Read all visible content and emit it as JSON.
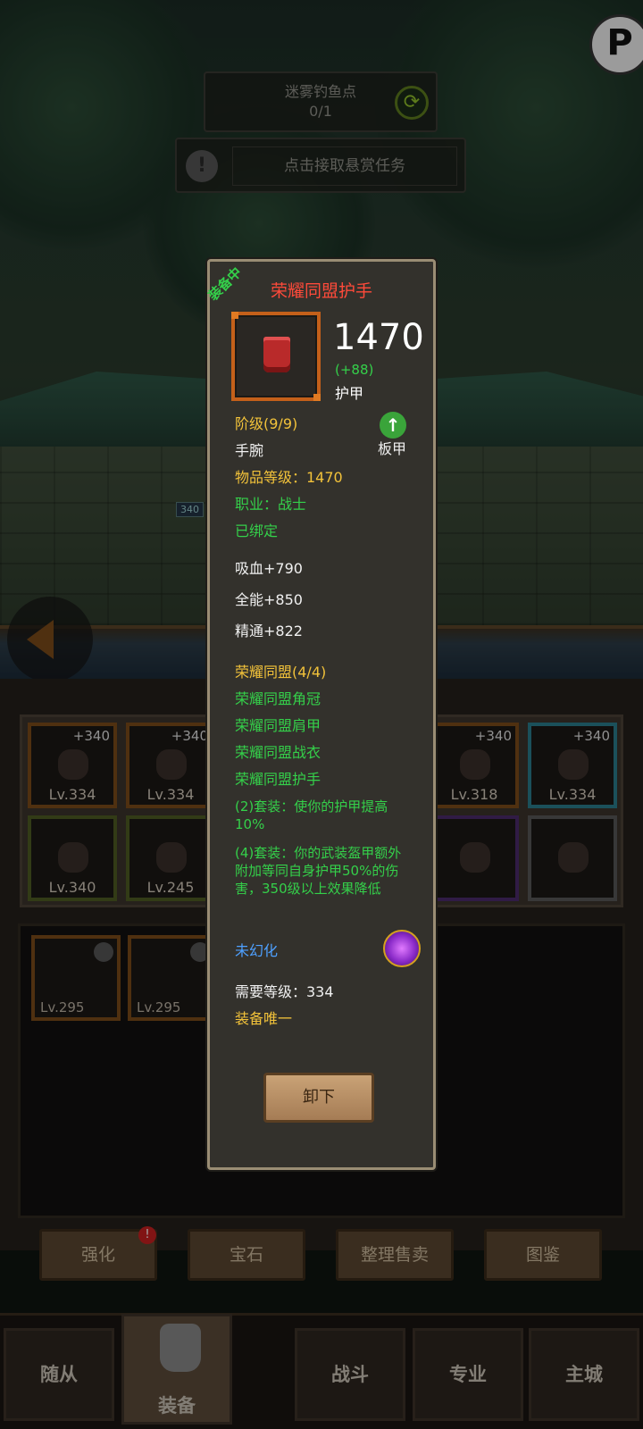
{
  "scene": {
    "quest_title": "迷雾钓鱼点",
    "quest_progress": "0/1",
    "bounty_label": "点击接取悬赏任务",
    "hp_tag": "340"
  },
  "equipped_slots": [
    {
      "plus": "+340",
      "level": "Lv.334"
    },
    {
      "plus": "+340",
      "level": "Lv.334"
    },
    {
      "plus": "+340",
      "level": "Lv.318"
    },
    {
      "plus": "+340",
      "level": "Lv.334"
    },
    {
      "plus": "",
      "level": "Lv.340"
    },
    {
      "plus": "",
      "level": "Lv.245"
    },
    {
      "plus": "",
      "level": ""
    },
    {
      "plus": "",
      "level": ""
    }
  ],
  "bag_items": [
    {
      "level": "Lv.295"
    },
    {
      "level": "Lv.295"
    }
  ],
  "actions": [
    "强化",
    "宝石",
    "整理售卖",
    "图鉴"
  ],
  "nav": {
    "tabs": [
      "随从",
      "装备",
      "战斗",
      "专业",
      "主城"
    ],
    "active": "装备"
  },
  "tooltip": {
    "equipped_tag": "装备中",
    "name": "荣耀同盟护手",
    "main_stat_value": "1470",
    "main_stat_delta": "(+88)",
    "main_stat_name": "护甲",
    "tier": "阶级(9/9)",
    "slot": "手腕",
    "armor_type": "板甲",
    "item_level": "物品等级：1470",
    "class_req": "职业：战士",
    "binding": "已绑定",
    "stats": [
      "吸血+790",
      "全能+850",
      "精通+822"
    ],
    "set_name": "荣耀同盟(4/4)",
    "set_pieces": [
      "荣耀同盟角冠",
      "荣耀同盟肩甲",
      "荣耀同盟战衣",
      "荣耀同盟护手"
    ],
    "set_bonus_2": "(2)套装：使你的护甲提高10%",
    "set_bonus_4": "(4)套装：你的武装盔甲额外附加等同自身护甲50%的伤害，350级以上效果降低",
    "transmog": "未幻化",
    "required_level": "需要等级：334",
    "unique": "装备唯一",
    "unequip_label": "卸下"
  },
  "colors": {
    "item_name": "#ff4a3a",
    "set_green": "#34d04a",
    "gold_text": "#f2c23a",
    "transmog_blue": "#4ea0ff"
  }
}
